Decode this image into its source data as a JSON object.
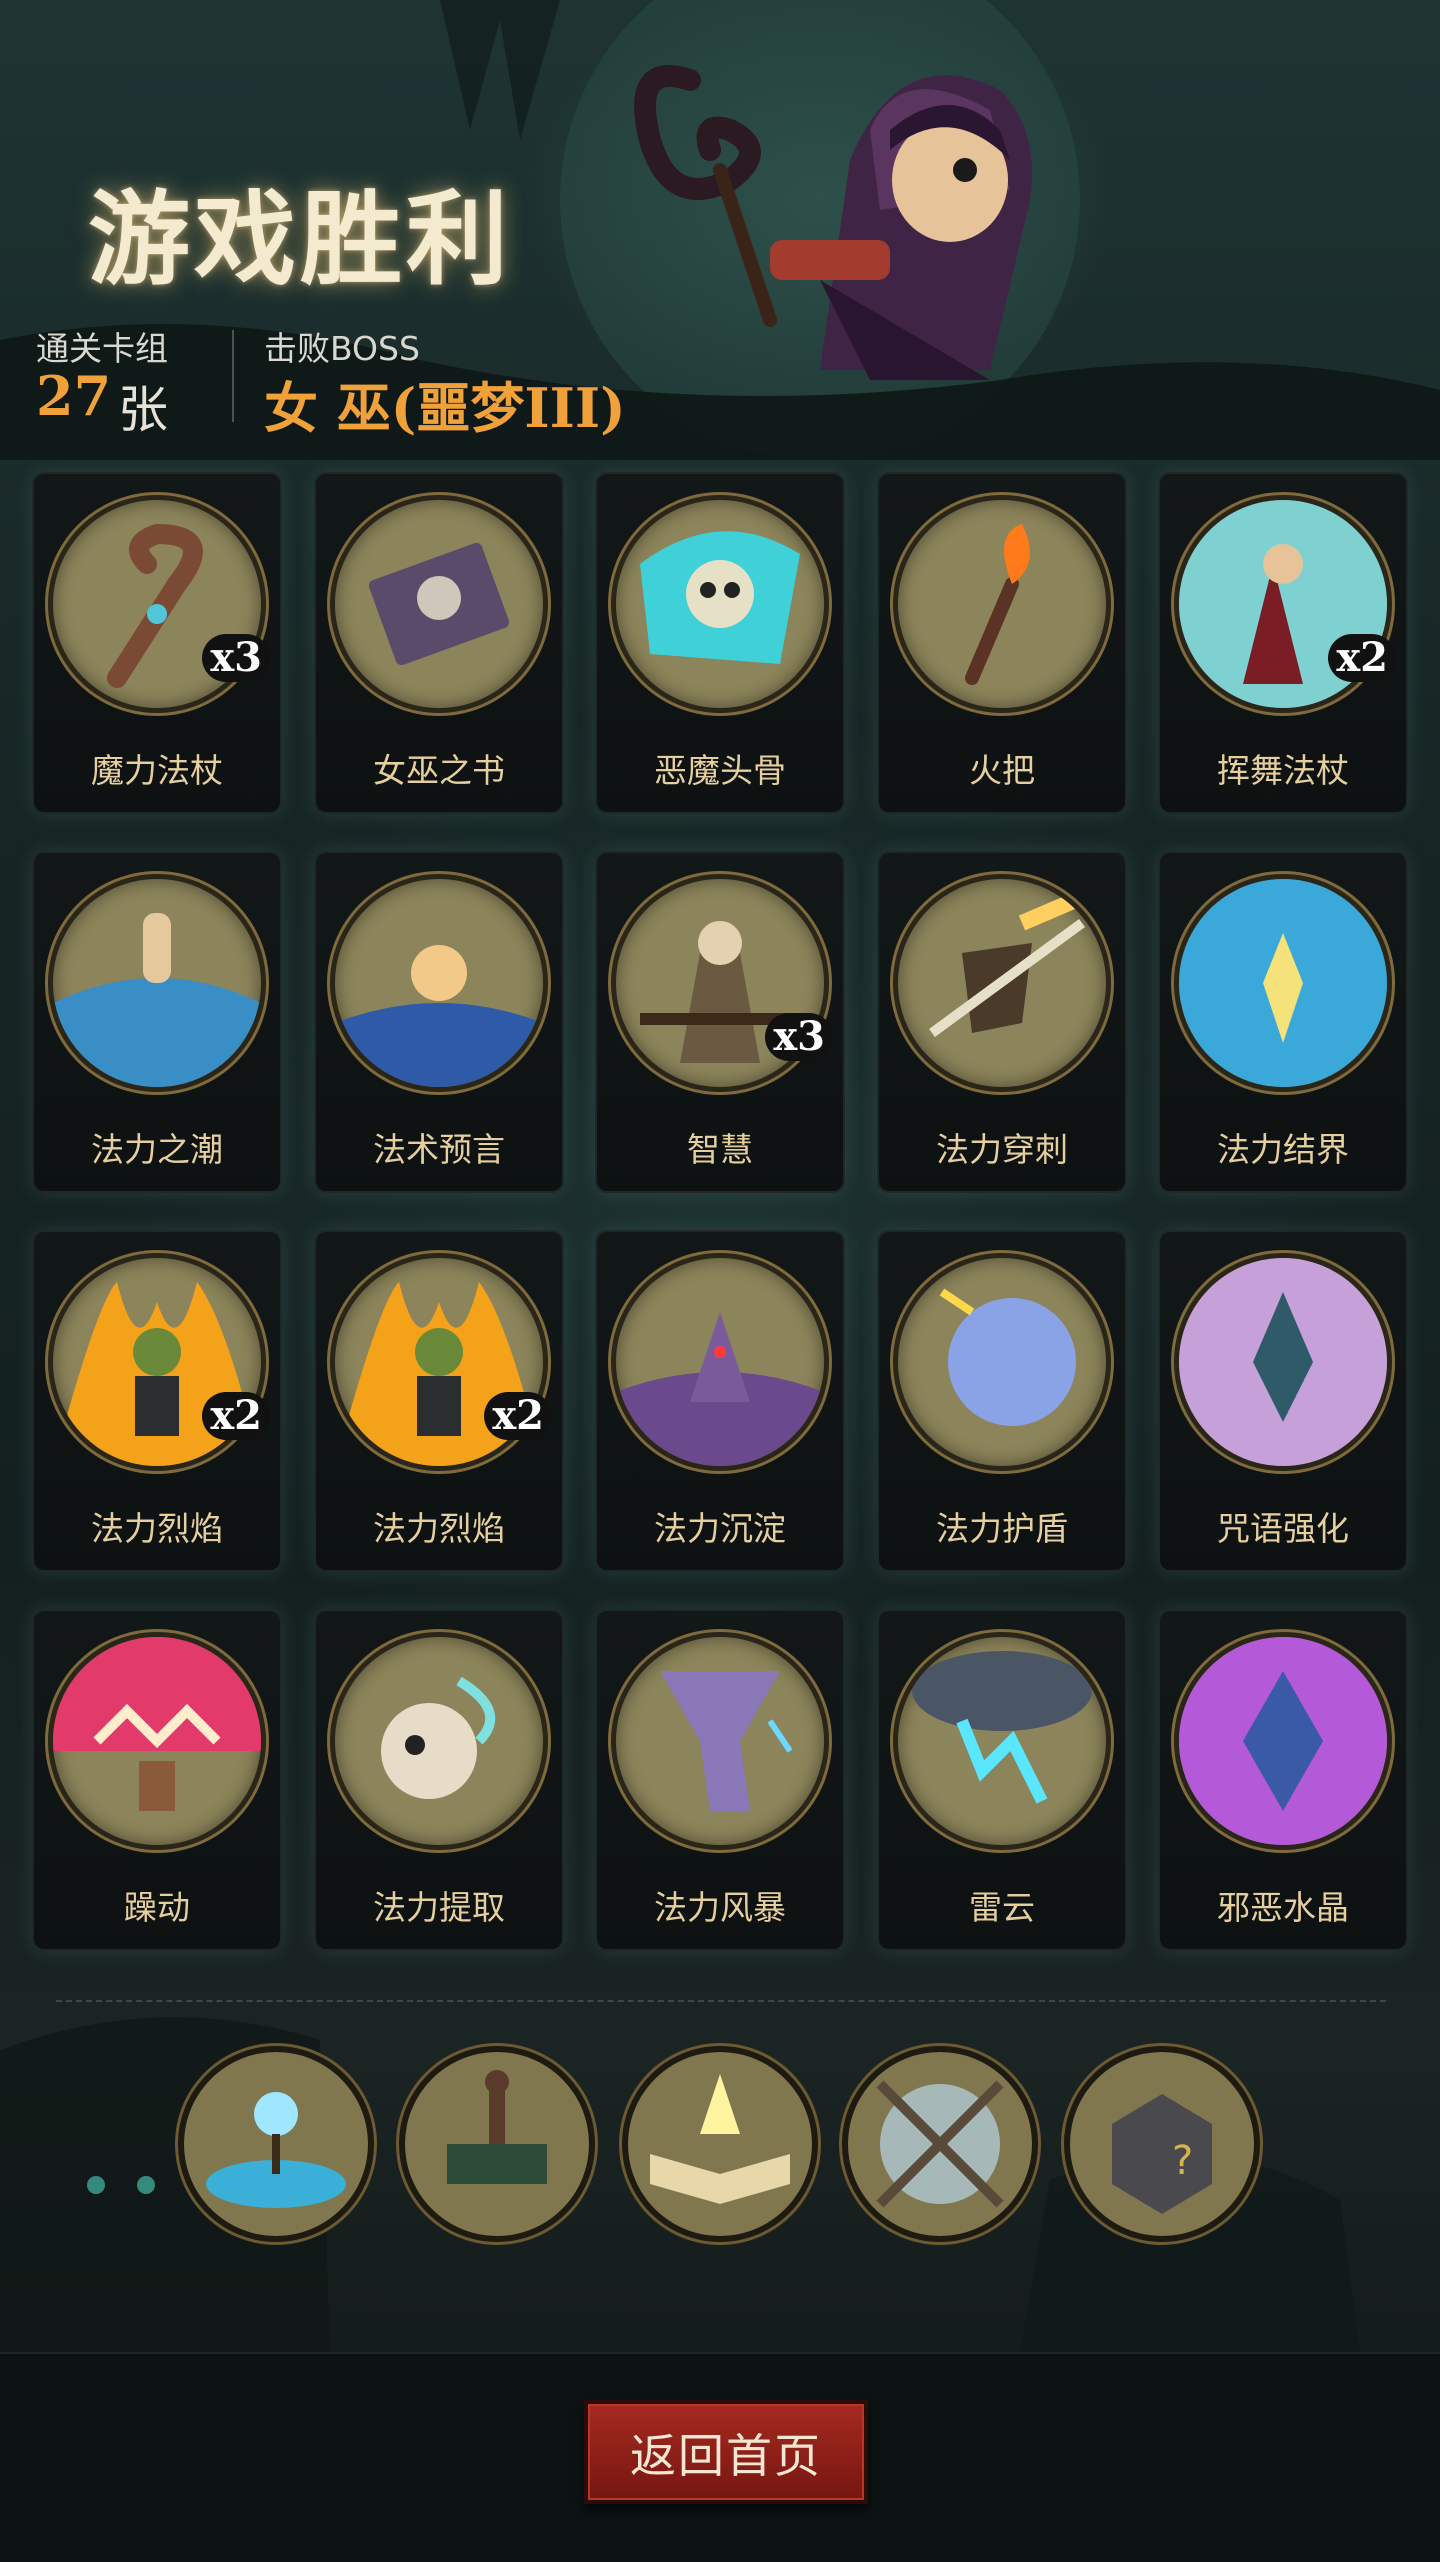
{
  "header": {
    "title": "游戏胜利",
    "clear_deck_label": "通关卡组",
    "clear_deck_count": "27",
    "clear_deck_unit": "张",
    "boss_label": "击败BOSS",
    "boss_name": "女 巫(噩梦III)"
  },
  "cards": [
    {
      "name": "魔力法杖",
      "count": "x3",
      "icon": "wooden-staff-icon"
    },
    {
      "name": "女巫之书",
      "count": "",
      "icon": "skull-book-icon"
    },
    {
      "name": "恶魔头骨",
      "count": "",
      "icon": "demon-skull-icon"
    },
    {
      "name": "火把",
      "count": "",
      "icon": "torch-icon"
    },
    {
      "name": "挥舞法杖",
      "count": "x2",
      "icon": "witch-staff-icon"
    },
    {
      "name": "法力之潮",
      "count": "",
      "icon": "tide-hand-icon"
    },
    {
      "name": "法术预言",
      "count": "",
      "icon": "crystal-ball-icon"
    },
    {
      "name": "智慧",
      "count": "x3",
      "icon": "sage-icon"
    },
    {
      "name": "法力穿刺",
      "count": "",
      "icon": "pierce-shield-icon"
    },
    {
      "name": "法力结界",
      "count": "",
      "icon": "barrier-hand-icon"
    },
    {
      "name": "法力烈焰",
      "count": "x2",
      "icon": "flame-goblin-icon"
    },
    {
      "name": "法力烈焰",
      "count": "x2",
      "icon": "flame-goblin-icon"
    },
    {
      "name": "法力沉淀",
      "count": "",
      "icon": "hooded-figure-icon"
    },
    {
      "name": "法力护盾",
      "count": "",
      "icon": "orb-shield-icon"
    },
    {
      "name": "咒语强化",
      "count": "",
      "icon": "crystal-empower-icon"
    },
    {
      "name": "躁动",
      "count": "",
      "icon": "frenzy-icon"
    },
    {
      "name": "法力提取",
      "count": "",
      "icon": "skull-extract-icon"
    },
    {
      "name": "法力风暴",
      "count": "",
      "icon": "tornado-icon"
    },
    {
      "name": "雷云",
      "count": "",
      "icon": "thundercloud-icon"
    },
    {
      "name": "邪恶水晶",
      "count": "",
      "icon": "evil-crystal-icon"
    }
  ],
  "relics": [
    {
      "icon": "water-orb-relic-icon"
    },
    {
      "icon": "general-map-relic-icon"
    },
    {
      "icon": "glowing-book-relic-icon"
    },
    {
      "icon": "crossed-staves-relic-icon"
    },
    {
      "icon": "mystery-box-relic-icon"
    }
  ],
  "footer": {
    "home_label": "返回首页"
  },
  "colors": {
    "accent_orange": "#f0a13a",
    "card_name": "#e6cf9e",
    "button_red": "#8a1e16"
  }
}
